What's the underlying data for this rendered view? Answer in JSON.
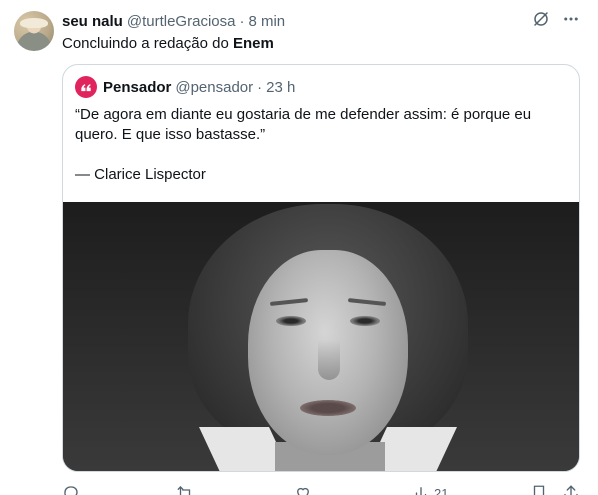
{
  "author": {
    "display_name": "seu nalu",
    "handle": "@turtleGraciosa",
    "separator": "·",
    "time": "8 min"
  },
  "tweet": {
    "text_prefix": "Concluindo a redação do ",
    "text_bold": "Enem"
  },
  "quoted": {
    "display_name": "Pensador",
    "handle": "@pensador",
    "separator": "·",
    "time": "23 h",
    "text_line1": "“De agora em diante eu gostaria de me defender assim: é porque eu",
    "text_line2": "quero. E que isso bastasse.”",
    "attribution": "— Clarice Lispector",
    "avatar_glyph": "❝"
  },
  "actions": {
    "reply_icon": "reply-icon",
    "retweet_icon": "retweet-icon",
    "like_icon": "like-icon",
    "views_icon": "views-icon",
    "views_count": "21",
    "bookmark_icon": "bookmark-icon",
    "share_icon": "share-icon"
  },
  "colors": {
    "text_primary": "#0f1419",
    "text_secondary": "#536471",
    "border": "#cfd9de",
    "pensador_red": "#e0245e"
  }
}
